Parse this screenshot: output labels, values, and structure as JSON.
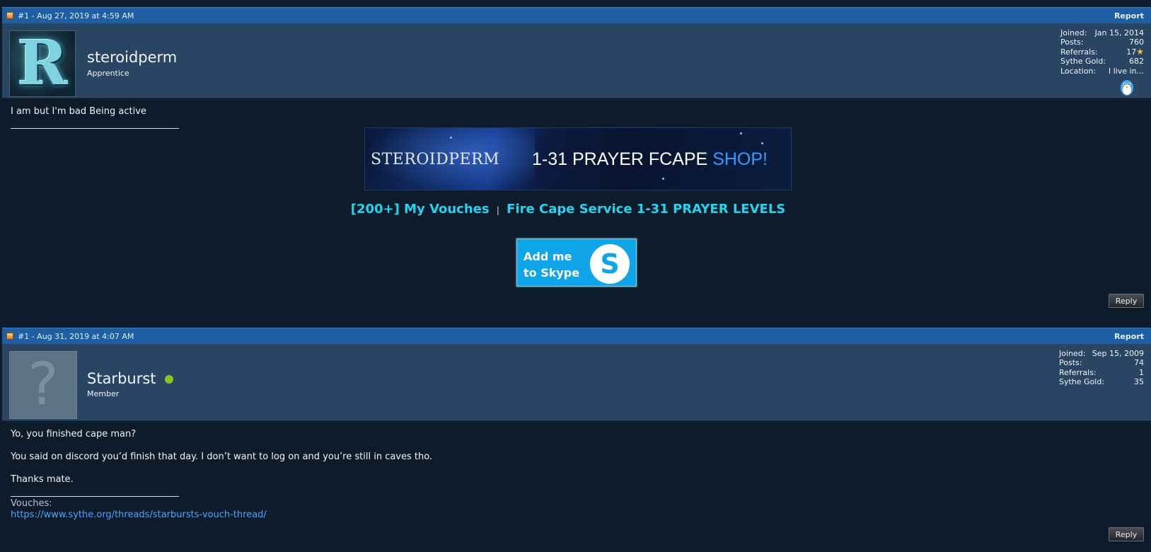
{
  "posts": [
    {
      "header": "#1 - Aug 27, 2019 at 4:59 AM",
      "report_label": "Report",
      "user": {
        "name": "steroidperm",
        "title": "Apprentice",
        "avatar_letter": "R",
        "online": false,
        "stats": [
          {
            "label": "Joined:",
            "value": "Jan 15, 2014"
          },
          {
            "label": "Posts:",
            "value": "760"
          },
          {
            "label": "Referrals:",
            "value": "17"
          },
          {
            "label": "Sythe Gold:",
            "value": "682"
          },
          {
            "label": "Location:",
            "value": "I live in..."
          }
        ],
        "referral_icon": "star-icon",
        "mascot_icon": "penguin-mascot-icon"
      },
      "body": {
        "message": "I am but I'm bad Being active",
        "banner": {
          "name": "STEROIDPERM",
          "tagline": "1-31 PRAYER FCAPE",
          "tagline_accent": "SHOP!"
        },
        "links": {
          "vouches": "[200+] My Vouches",
          "separator": "|",
          "service": "Fire Cape Service 1-31 PRAYER LEVELS"
        },
        "skype": {
          "line1": "Add me",
          "line2": "to Skype",
          "logo_letter": "S"
        }
      },
      "reply_label": "Reply"
    },
    {
      "header": "#1 - Aug 31, 2019 at 4:07 AM",
      "report_label": "Report",
      "user": {
        "name": "Starburst",
        "title": "Member",
        "avatar_placeholder": "?",
        "online": true,
        "stats": [
          {
            "label": "Joined:",
            "value": "Sep 15, 2009"
          },
          {
            "label": "Posts:",
            "value": "74"
          },
          {
            "label": "Referrals:",
            "value": "1"
          },
          {
            "label": "Sythe Gold:",
            "value": "35"
          }
        ]
      },
      "body": {
        "lines": [
          "Yo, you finished cape man?",
          "You said on discord you’d finish that day. I don’t want to log on and you’re still in caves tho.",
          "Thanks mate."
        ],
        "vouches_label": "Vouches:",
        "vouches_link": "https://www.sythe.org/threads/starbursts-vouch-thread/"
      },
      "reply_label": "Reply"
    }
  ],
  "colors": {
    "header_bar": "#1e5fa3",
    "userbar": "#294563",
    "body_bg": "#0d1b2a",
    "link_cyan": "#22d4ee",
    "online_green": "#8dc21f",
    "skype_blue": "#0fa5e8"
  }
}
